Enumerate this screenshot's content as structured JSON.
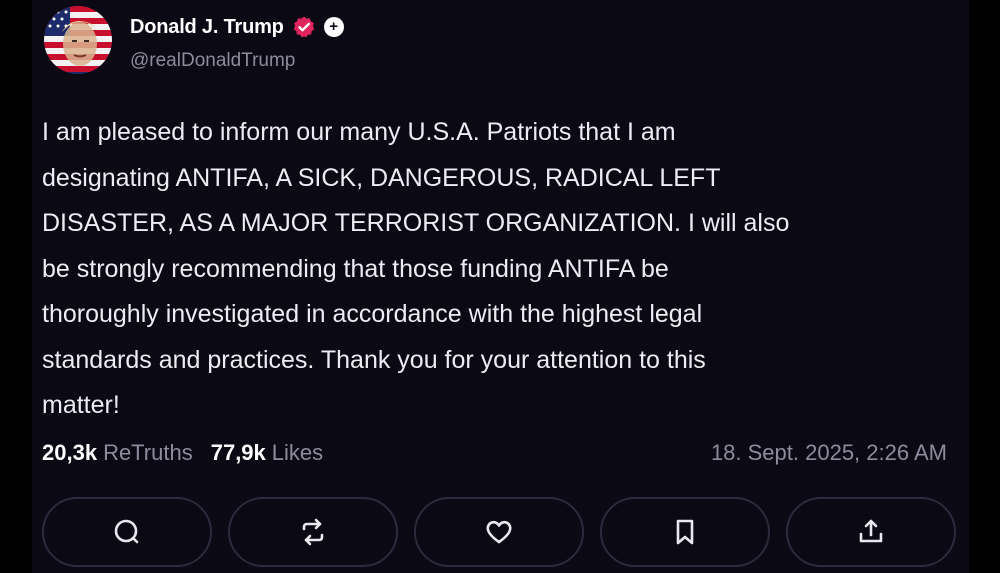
{
  "post": {
    "author": {
      "display_name": "Donald J. Trump",
      "handle": "@realDonaldTrump",
      "verified_icon": "verified-badge-icon",
      "plus_badge": "+",
      "avatar_icon": "flag-portrait-avatar"
    },
    "text": "I am pleased to inform our many U.S.A. Patriots that I am\ndesignating ANTIFA, A SICK, DANGEROUS, RADICAL LEFT\nDISASTER, AS A MAJOR TERRORIST ORGANIZATION. I will also\nbe strongly recommending that those funding ANTIFA be\nthoroughly investigated in accordance with the highest legal\nstandards and practices. Thank you for your attention to this\nmatter!",
    "stats": {
      "retruths_count": "20,3k",
      "retruths_label": "ReTruths",
      "likes_count": "77,9k",
      "likes_label": "Likes"
    },
    "timestamp": "18. Sept. 2025, 2:26 AM"
  },
  "actions": [
    {
      "name": "reply",
      "icon": "comment-icon"
    },
    {
      "name": "retruth",
      "icon": "repost-icon"
    },
    {
      "name": "like",
      "icon": "heart-icon"
    },
    {
      "name": "bookmark",
      "icon": "bookmark-icon"
    },
    {
      "name": "share",
      "icon": "share-icon"
    }
  ],
  "colors": {
    "background": "#0b0914",
    "verified": "#e0245e",
    "text": "#ececf2",
    "muted": "#8c8c9c",
    "button_border": "#2c2a3c"
  }
}
